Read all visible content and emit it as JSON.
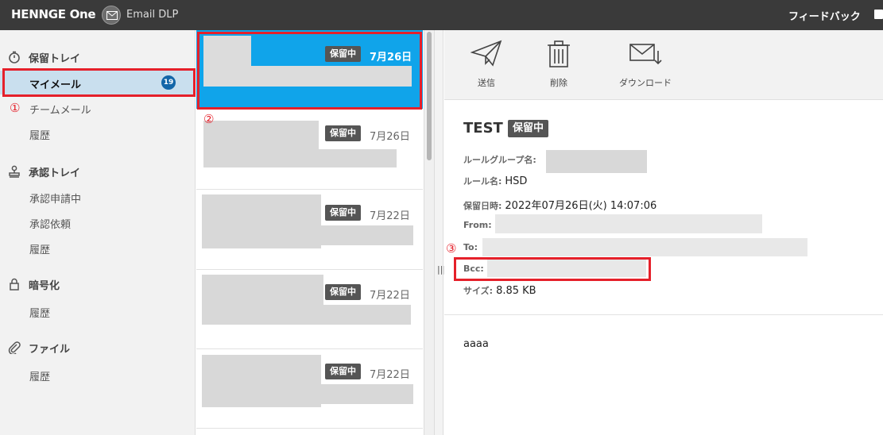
{
  "topbar": {
    "brand": "HENNGE One",
    "product": "Email DLP",
    "feedback": "フィードバック"
  },
  "sidebar": {
    "hold_tray": "保留トレイ",
    "my_mail": "マイメール",
    "my_mail_count": "19",
    "team_mail": "チームメール",
    "history1": "履歴",
    "approval_tray": "承認トレイ",
    "approval_request": "承認申請中",
    "approval_ask": "承認依頼",
    "history2": "履歴",
    "encryption": "暗号化",
    "history3": "履歴",
    "file": "ファイル",
    "history4": "履歴"
  },
  "annotations": {
    "n1": "①",
    "n2": "②",
    "n3": "③"
  },
  "mail_list": [
    {
      "status": "保留中",
      "date": "7月26日",
      "selected": true
    },
    {
      "status": "保留中",
      "date": "7月26日"
    },
    {
      "status": "保留中",
      "date": "7月22日"
    },
    {
      "status": "保留中",
      "date": "7月22日"
    },
    {
      "status": "保留中",
      "date": "7月22日"
    }
  ],
  "toolbar": {
    "send": "送信",
    "delete": "削除",
    "download": "ダウンロード"
  },
  "detail": {
    "subject": "TEST",
    "status": "保留中",
    "rule_group_label": "ルールグループ名:",
    "rule_name_label": "ルール名:",
    "rule_name": "HSD",
    "hold_date_label": "保留日時:",
    "hold_date": "2022年07月26日(火) 14:07:06",
    "from_label": "From:",
    "to_label": "To:",
    "bcc_label": "Bcc:",
    "size_label": "サイズ:",
    "size": "8.85 KB",
    "body": "aaaa"
  },
  "colors": {
    "topbar": "#3a3a3a",
    "selected": "#10a4ea",
    "accent_red": "#e5202a",
    "badge_blue": "#1366a8"
  }
}
